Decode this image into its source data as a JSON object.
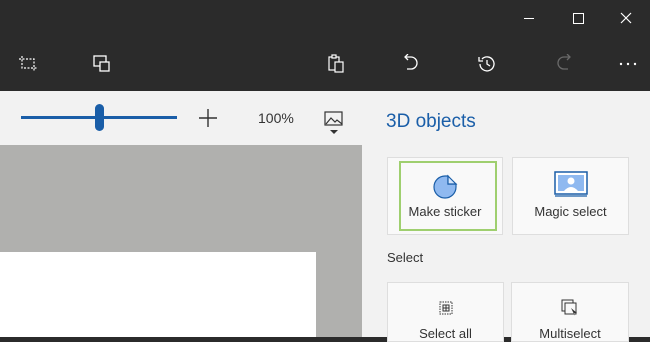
{
  "window": {
    "minimize_icon": "minimize-icon",
    "maximize_icon": "maximize-icon",
    "close_icon": "close-icon"
  },
  "toolbar": {
    "icons": [
      "crop-icon",
      "paste-icon",
      "clipboard-icon",
      "undo-icon",
      "history-icon",
      "redo-icon",
      "more-icon"
    ]
  },
  "zoom": {
    "value_label": "100%",
    "slider_level_fraction": 0.5
  },
  "panel": {
    "title": "3D objects",
    "tiles": [
      {
        "label": "Make sticker",
        "icon": "sticker-icon",
        "selected": true
      },
      {
        "label": "Magic select",
        "icon": "magic-select-icon",
        "selected": false
      }
    ],
    "select_section_label": "Select",
    "select_tiles": [
      {
        "label": "Select all",
        "icon": "select-all-icon"
      },
      {
        "label": "Multiselect",
        "icon": "multiselect-icon"
      }
    ]
  },
  "colors": {
    "accent": "#1a5ea8",
    "selected_border": "#9fcf6f",
    "chrome": "#2b2b2b"
  }
}
